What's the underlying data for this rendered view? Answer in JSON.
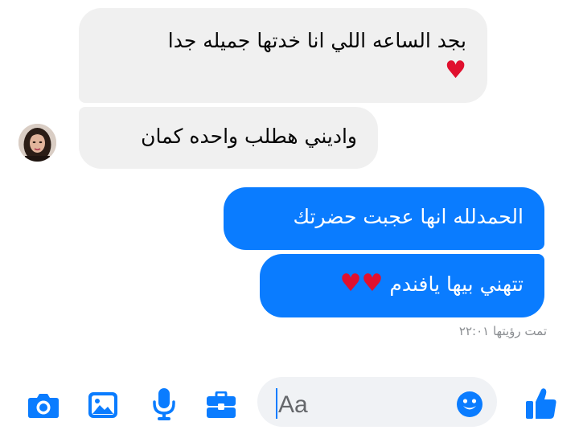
{
  "conversation": {
    "incoming": [
      {
        "line1": "بجد الساعه اللي انا خدتها جميله جدا",
        "emoji": "♥"
      },
      {
        "text": "واديني هطلب واحده كمان"
      }
    ],
    "outgoing": [
      {
        "text": "الحمدلله انها عجبت حضرتك"
      },
      {
        "text": "تتهني بيها يافندم",
        "emoji": "♥♥"
      }
    ],
    "seen_label": "تمت رؤيتها ٢٢:٠١"
  },
  "composer": {
    "placeholder": "Aa"
  },
  "toolbar": {
    "icons": [
      "camera-icon",
      "photo-icon",
      "microphone-icon",
      "toolkit-icon",
      "emoji-icon",
      "thumbs-up-icon"
    ]
  },
  "colors": {
    "accent": "#0a7cff",
    "incoming_bubble": "#f0f0f0",
    "heart": "#e0102e",
    "seen_text": "#8a8d91"
  }
}
